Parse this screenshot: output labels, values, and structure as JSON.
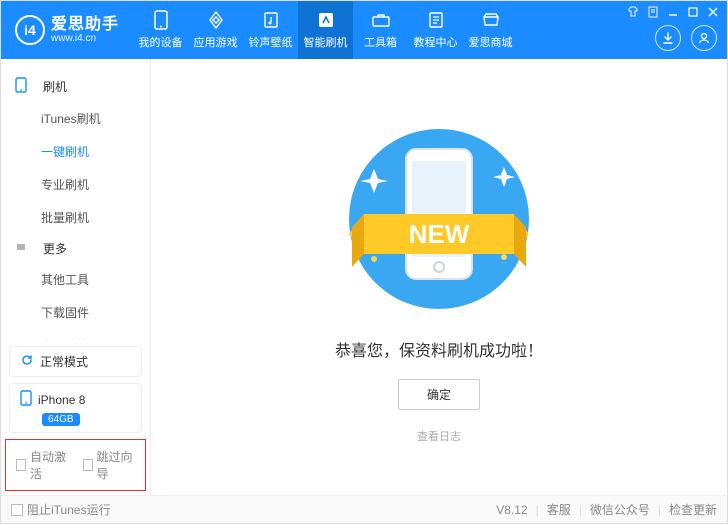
{
  "brand": {
    "name": "爱思助手",
    "url": "www.i4.cn",
    "logo_letter": "i4"
  },
  "titlebar_icons": [
    "tshirt-icon",
    "note-icon",
    "minimize-icon",
    "maximize-icon",
    "close-icon"
  ],
  "nav": {
    "items": [
      {
        "label": "我的设备",
        "icon": "phone-icon"
      },
      {
        "label": "应用游戏",
        "icon": "apps-icon"
      },
      {
        "label": "铃声壁纸",
        "icon": "music-icon"
      },
      {
        "label": "智能刷机",
        "icon": "flash-icon",
        "active": true
      },
      {
        "label": "工具箱",
        "icon": "toolbox-icon"
      },
      {
        "label": "教程中心",
        "icon": "book-icon"
      },
      {
        "label": "爱思商城",
        "icon": "shop-icon"
      }
    ]
  },
  "header_right": {
    "download": "download-icon",
    "user": "user-icon"
  },
  "sidebar": {
    "cat1": {
      "title": "刷机",
      "items": [
        "iTunes刷机",
        "一键刷机",
        "专业刷机",
        "批量刷机"
      ],
      "active_index": 1
    },
    "cat2": {
      "title": "更多",
      "items": [
        "其他工具",
        "下载固件",
        "高级功能"
      ]
    },
    "mode": "正常模式",
    "device": {
      "name": "iPhone 8",
      "capacity": "64GB"
    },
    "opts": {
      "auto_activate": "自动激活",
      "skip_guide": "跳过向导"
    }
  },
  "main": {
    "ribbon_text": "NEW",
    "success_text": "恭喜您，保资料刷机成功啦！",
    "confirm_label": "确定",
    "log_label": "查看日志"
  },
  "footer": {
    "block_itunes": "阻止iTunes运行",
    "version": "V8.12",
    "links": [
      "客服",
      "微信公众号",
      "检查更新"
    ]
  }
}
